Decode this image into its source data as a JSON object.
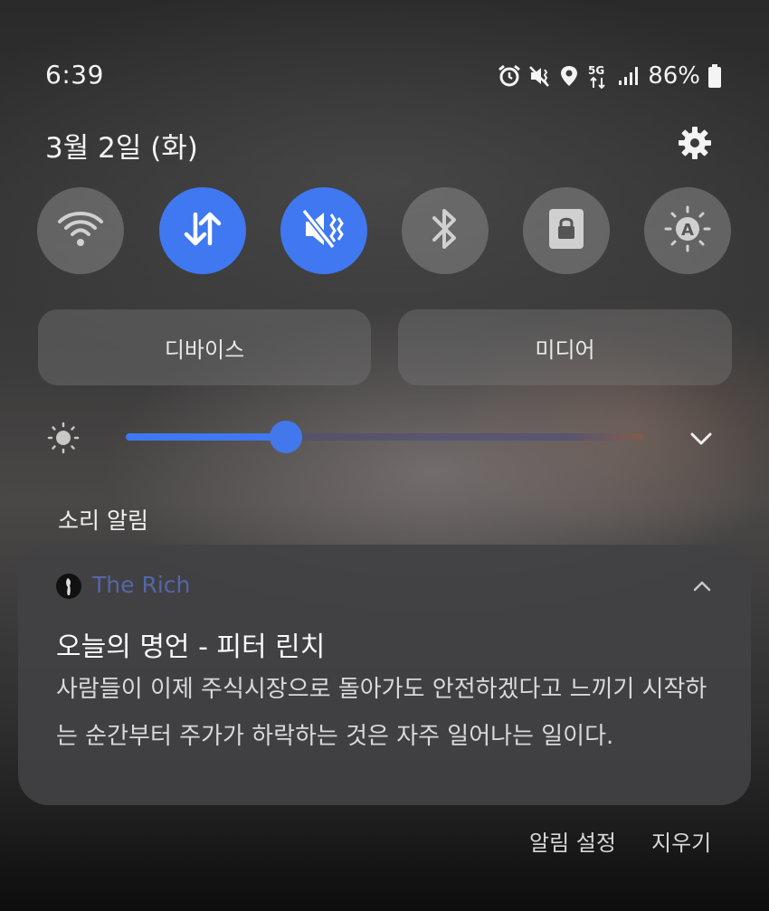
{
  "status_bar": {
    "time": "6:39",
    "battery": "86%",
    "network_label": "5G"
  },
  "header": {
    "date": "3월 2일 (화)"
  },
  "quick_tiles": [
    {
      "name": "wifi",
      "state": "off",
      "icon": "wifi-icon"
    },
    {
      "name": "mobile-data",
      "state": "on",
      "icon": "up-down-arrows-icon"
    },
    {
      "name": "sound-mode",
      "state": "on",
      "icon": "vibrate-icon"
    },
    {
      "name": "bluetooth",
      "state": "off",
      "icon": "bluetooth-icon"
    },
    {
      "name": "screen-lock",
      "state": "off",
      "icon": "lock-icon"
    },
    {
      "name": "auto-brightness",
      "state": "off",
      "icon": "auto-brightness-icon"
    }
  ],
  "buttons": {
    "devices": "디바이스",
    "media": "미디어"
  },
  "brightness": {
    "level": 0.31
  },
  "section_label": "소리 알림",
  "notification": {
    "app_name": "The Rich",
    "title": "오늘의 명언 - 피터 린치",
    "body": "사람들이 이제 주식시장으로 돌아가도 안전하겠다고 느끼기 시작하는 순간부터 주가가 하락하는 것은 자주 일어나는 일이다."
  },
  "footer": {
    "settings": "알림 설정",
    "clear": "지우기"
  },
  "colors": {
    "accent": "#3f78f1",
    "app_name": "#5566a6"
  }
}
